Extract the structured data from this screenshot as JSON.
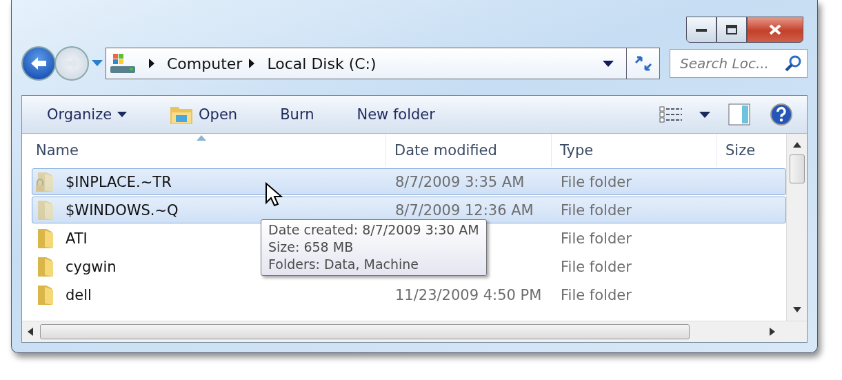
{
  "address_bar": {
    "crumbs": [
      "Computer",
      "Local Disk (C:)"
    ]
  },
  "search": {
    "placeholder": "Search Loc..."
  },
  "toolbar": {
    "buttons": [
      {
        "label": "Organize",
        "kind": "menu"
      },
      {
        "label": "Open",
        "kind": "folder"
      },
      {
        "label": "Burn",
        "kind": "plain"
      },
      {
        "label": "New folder",
        "kind": "plain"
      }
    ]
  },
  "table": {
    "columns": [
      {
        "label": "Name",
        "sorted": true
      },
      {
        "label": "Date modified",
        "sorted": false
      },
      {
        "label": "Type",
        "sorted": false
      },
      {
        "label": "Size",
        "sorted": false
      }
    ],
    "rows": [
      {
        "name": "$INPLACE.~TR",
        "date": "8/7/2009 3:35 AM",
        "type": "File folder",
        "selected": true,
        "hidden": true,
        "locked": true
      },
      {
        "name": "$WINDOWS.~Q",
        "date": "8/7/2009 12:36 AM",
        "type": "File folder",
        "selected": true,
        "hidden": true,
        "locked": false
      },
      {
        "name": "ATI",
        "type": "File folder",
        "selected": false,
        "hidden": false,
        "locked": false
      },
      {
        "name": "cygwin",
        "type": "File folder",
        "selected": false,
        "hidden": false,
        "locked": false
      },
      {
        "name": "dell",
        "date": "11/23/2009 4:50 PM",
        "type": "File folder",
        "selected": false,
        "hidden": false,
        "locked": false
      }
    ]
  },
  "tooltip": {
    "lines": [
      "Date created: 8/7/2009 3:30 AM",
      "Size: 658 MB",
      "Folders: Data, Machine"
    ]
  }
}
